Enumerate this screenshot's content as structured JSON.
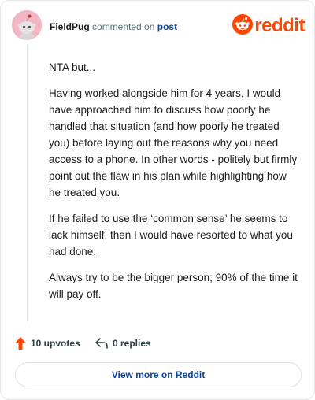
{
  "comment": {
    "author": "FieldPug",
    "verb": "commented on",
    "target": "post",
    "paragraphs": [
      "NTA but...",
      "Having worked alongside him for 4 years, I would have approached him to discuss how poorly he handled that situation (and how poorly he treated you) before laying out the reasons why you need access to a phone. In other words - politely but firmly point out the flaw in his plan while highlighting how he treated you.",
      "If he failed to use the ‘common sense’ he seems to lack himself, then I would have resorted to what you had done.",
      "Always try to be the bigger person; 90% of the time it will pay off."
    ]
  },
  "brand": {
    "wordmark": "reddit",
    "color": "#ff4500",
    "icon": "reddit-snoo-icon"
  },
  "avatar": {
    "icon": "snoo-avatar-icon",
    "background": "#f3b5c4"
  },
  "actions": {
    "upvotes_label": "10 upvotes",
    "upvote_icon": "upvote-arrow-icon",
    "upvote_color": "#ff4500",
    "replies_label": "0 replies",
    "reply_icon": "reply-arrow-icon"
  },
  "footer": {
    "button_label": "View more on Reddit"
  },
  "colors": {
    "link": "#0a449b",
    "muted": "#576f76",
    "text": "#1c1c1c"
  }
}
